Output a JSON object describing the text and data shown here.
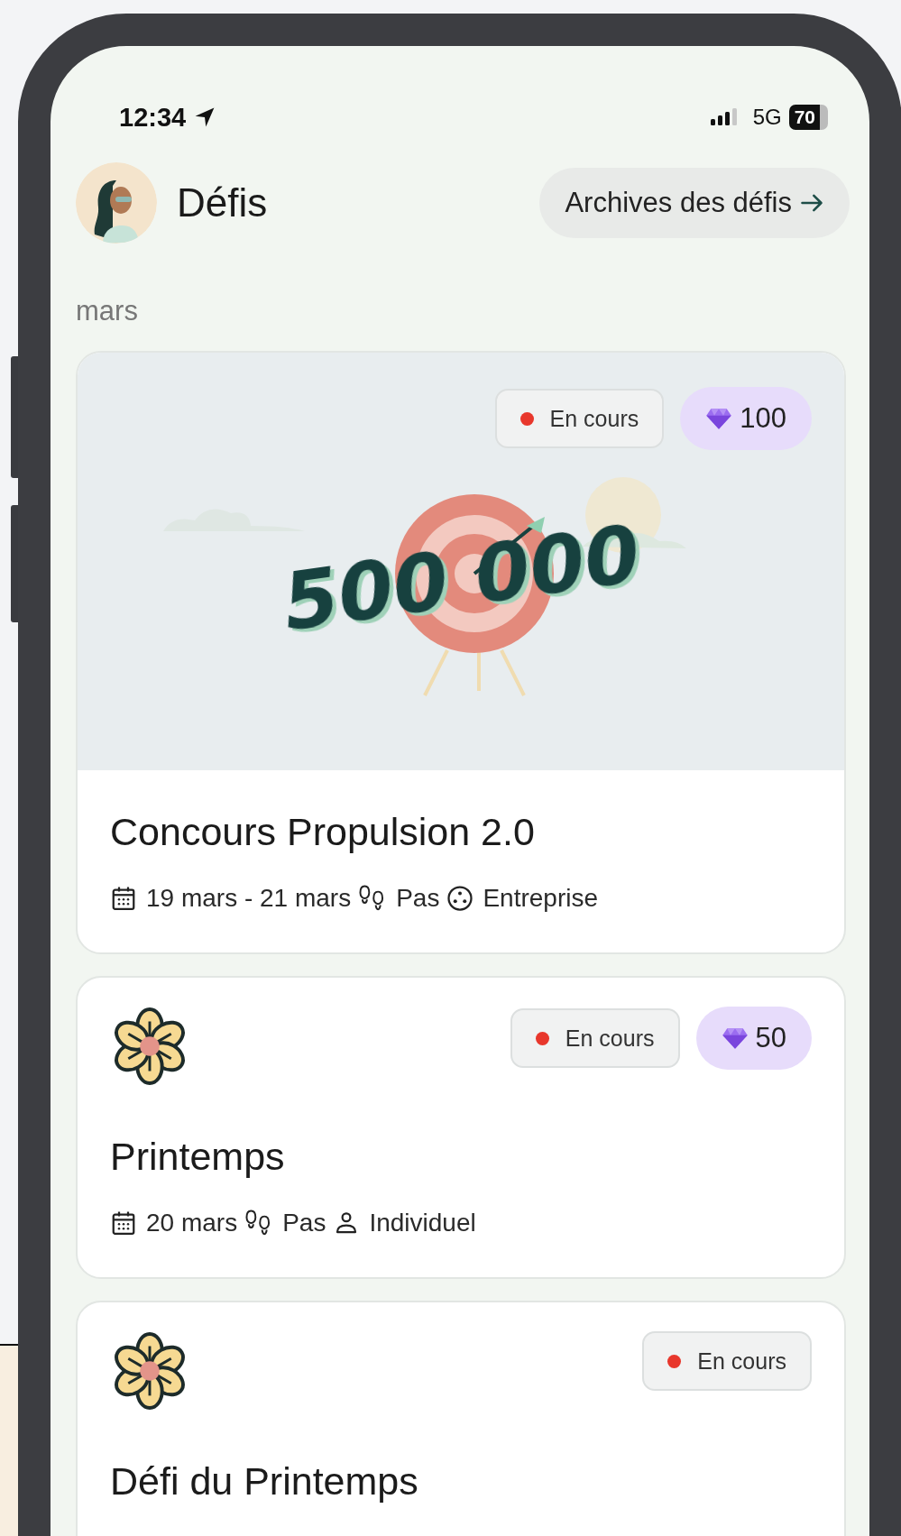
{
  "status_bar": {
    "time": "12:34",
    "network": "5G",
    "battery": "70"
  },
  "header": {
    "title": "Défis",
    "archive_button": "Archives des défis"
  },
  "month": "mars",
  "challenges": [
    {
      "kind": "banner",
      "banner_text": "500 000",
      "status": {
        "label": "En cours",
        "color": "#e8372c"
      },
      "reward": "100",
      "title": "Concours Propulsion 2.0",
      "meta": [
        {
          "kind": "date",
          "text": "19 mars - 21 mars"
        },
        {
          "kind": "steps",
          "text": "Pas"
        },
        {
          "kind": "team",
          "text": "Entreprise"
        }
      ]
    },
    {
      "kind": "flower",
      "status": {
        "label": "En cours",
        "color": "#e8372c"
      },
      "reward": "50",
      "title": "Printemps",
      "meta": [
        {
          "kind": "date",
          "text": "20 mars"
        },
        {
          "kind": "steps",
          "text": "Pas"
        },
        {
          "kind": "person",
          "text": "Individuel"
        }
      ]
    },
    {
      "kind": "flower",
      "status": {
        "label": "En cours",
        "color": "#e8372c"
      },
      "title": "Défi du Printemps"
    }
  ]
}
